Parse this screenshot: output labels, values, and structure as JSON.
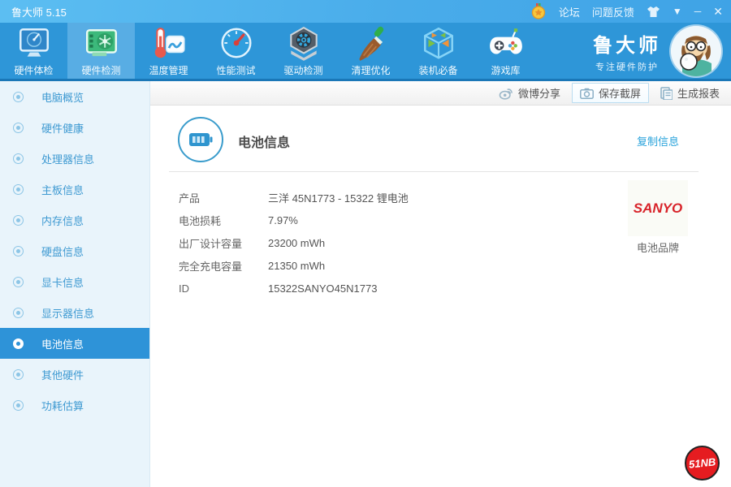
{
  "window": {
    "title": "鲁大师 5.15",
    "controls": {
      "dropdown": "▼",
      "minimize": "─",
      "close": "✕"
    }
  },
  "titlebar": {
    "medal_icon": "medal-icon",
    "links": [
      {
        "label": "论坛"
      },
      {
        "label": "问题反馈"
      }
    ]
  },
  "toolbar": {
    "tabs": [
      {
        "label": "硬件体检",
        "icon": "monitor-radar-icon",
        "active": false
      },
      {
        "label": "硬件检测",
        "icon": "gpu-card-icon",
        "active": true
      },
      {
        "label": "温度管理",
        "icon": "thermometer-chart-icon",
        "active": false
      },
      {
        "label": "性能测试",
        "icon": "gauge-icon",
        "active": false
      },
      {
        "label": "驱动检测",
        "icon": "driver-gear-icon",
        "active": false
      },
      {
        "label": "清理优化",
        "icon": "broom-icon",
        "active": false
      },
      {
        "label": "装机必备",
        "icon": "cube-icon",
        "active": false
      },
      {
        "label": "游戏库",
        "icon": "gamepad-icon",
        "active": false
      }
    ]
  },
  "brand": {
    "name": "鲁大师",
    "tagline": "专注硬件防护"
  },
  "subtoolbar": {
    "weibo_share": "微博分享",
    "save_screenshot": "保存截屏",
    "generate_report": "生成报表"
  },
  "sidebar": {
    "items": [
      {
        "label": "电脑概览",
        "active": false
      },
      {
        "label": "硬件健康",
        "active": false
      },
      {
        "label": "处理器信息",
        "active": false
      },
      {
        "label": "主板信息",
        "active": false
      },
      {
        "label": "内存信息",
        "active": false
      },
      {
        "label": "硬盘信息",
        "active": false
      },
      {
        "label": "显卡信息",
        "active": false
      },
      {
        "label": "显示器信息",
        "active": false
      },
      {
        "label": "电池信息",
        "active": true
      },
      {
        "label": "其他硬件",
        "active": false
      },
      {
        "label": "功耗估算",
        "active": false
      }
    ]
  },
  "main": {
    "title": "电池信息",
    "copy_link": "复制信息",
    "rows": [
      {
        "label": "产品",
        "value": "三洋 45N1773 - 15322 锂电池"
      },
      {
        "label": "电池损耗",
        "value": "7.97%"
      },
      {
        "label": "出厂设计容量",
        "value": "23200 mWh"
      },
      {
        "label": "完全充电容量",
        "value": "21350 mWh"
      },
      {
        "label": "ID",
        "value": "15322SANYO45N1773"
      }
    ],
    "battery_brand": {
      "logo_text": "SANYO",
      "caption": "电池品牌"
    }
  },
  "watermark": {
    "text": "51NB"
  },
  "colors": {
    "accent_blue": "#2e96d8",
    "titlebar_blue": "#4fb3ec",
    "sidebar_bg": "#e9f4fb",
    "active_item": "#2e93d8",
    "link_blue": "#29a3db",
    "sanyo_red": "#d8232a",
    "watermark_red": "#e51c20"
  }
}
